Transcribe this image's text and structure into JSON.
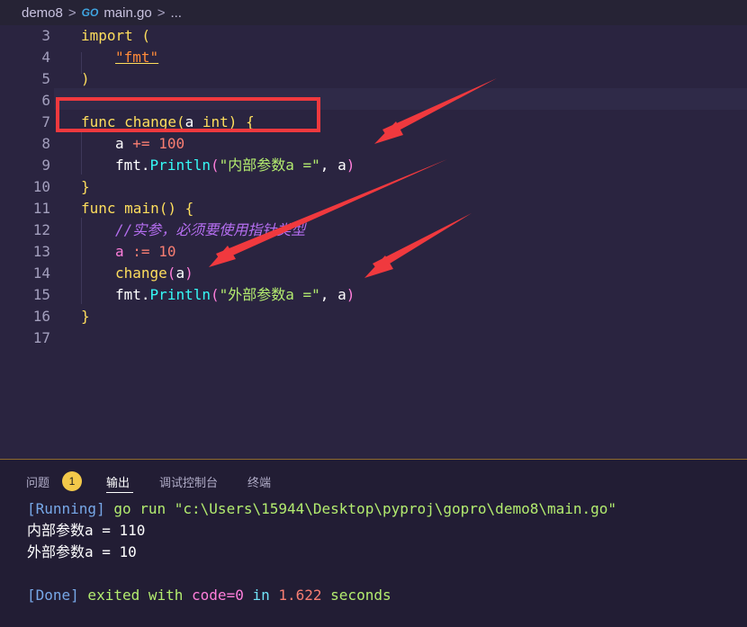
{
  "breadcrumb": {
    "folder": "demo8",
    "sep": ">",
    "go_badge": "GO",
    "file": "main.go",
    "sep2": ">",
    "more": "..."
  },
  "editor": {
    "line_numbers": [
      "3",
      "4",
      "5",
      "6",
      "7",
      "8",
      "9",
      "10",
      "11",
      "12",
      "13",
      "14",
      "15",
      "16",
      "17"
    ],
    "code": {
      "l3": "import (",
      "l4_str": "\"fmt\"",
      "l5": ")",
      "l7_func": "func",
      "l7_name": "change",
      "l7_open": "(",
      "l7_param": "a",
      "l7_type": "int",
      "l7_close": ")",
      "l7_brace": "{",
      "l8_var": "a",
      "l8_op": "+=",
      "l8_num": "100",
      "l9_pkg": "fmt",
      "l9_dot": ".",
      "l9_fn": "Println",
      "l9_open": "(",
      "l9_str": "\"内部参数a =\"",
      "l9_rest": ", a",
      "l9_close": ")",
      "l10": "}",
      "l11_func": "func",
      "l11_name": "main",
      "l11_paren": "()",
      "l11_brace": "{",
      "l12_comment": "//实参，必须要使用指针类型",
      "l13_var": "a",
      "l13_op": ":=",
      "l13_num": "10",
      "l14_fn": "change",
      "l14_open": "(",
      "l14_arg": "a",
      "l14_close": ")",
      "l15_pkg": "fmt",
      "l15_dot": ".",
      "l15_fn": "Println",
      "l15_open": "(",
      "l15_str": "\"外部参数a =\"",
      "l15_rest": ", a",
      "l15_close": ")",
      "l16": "}"
    }
  },
  "panel": {
    "tabs": {
      "problems": "问题",
      "problems_count": "1",
      "output": "输出",
      "debug_console": "调试控制台",
      "terminal": "终端"
    },
    "output": {
      "run_tag": "[Running]",
      "run_cmd": " go run \"c:\\Users\\15944\\Desktop\\pyproj\\gopro\\demo8\\main.go\"",
      "line1": "内部参数a = 110",
      "line2": "外部参数a = 10",
      "done_tag": "[Done]",
      "done_exited": " exited ",
      "done_with": "with ",
      "done_code": "code=0",
      "done_in": " in ",
      "done_time": "1.622",
      "done_seconds": " seconds"
    }
  },
  "annotation_colors": {
    "highlight_box": "#f0393e",
    "arrow": "#f0393e"
  }
}
